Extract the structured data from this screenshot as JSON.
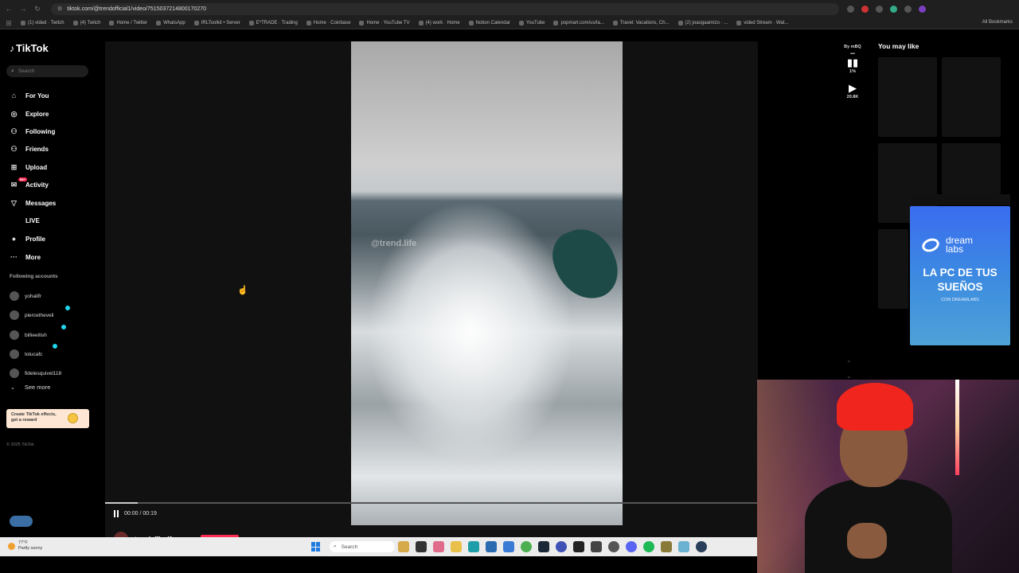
{
  "browser": {
    "url": "tiktok.com/@trendofficial1/video/7515037214800170270",
    "bookmarks": [
      "(1) vided · Twitch",
      "(4) Twitch",
      "Home / Twitter",
      "WhatsApp",
      "IRLToolkit • Server",
      "E*TRADE · Trading",
      "Home · Coinbase",
      "Home · YouTube TV",
      "(4) work · Home",
      "Notion Calendar",
      "YouTube",
      "popmart.com/us/la...",
      "Travel: Vacations, Ch...",
      "(2) joaogaarnizo · ...",
      "vided Stream · Wat..."
    ],
    "all_bookmarks": "All Bookmarks"
  },
  "sidebar": {
    "logo": "TikTok",
    "search_placeholder": "Search",
    "nav": [
      {
        "label": "For You",
        "icon": "home-icon",
        "glyph": "⌂"
      },
      {
        "label": "Explore",
        "icon": "compass-icon",
        "glyph": "◎"
      },
      {
        "label": "Following",
        "icon": "following-icon",
        "glyph": "⚇"
      },
      {
        "label": "Friends",
        "icon": "friends-icon",
        "glyph": "⚇"
      },
      {
        "label": "Upload",
        "icon": "upload-icon",
        "glyph": "⊞"
      },
      {
        "label": "Activity",
        "icon": "activity-icon",
        "glyph": "✉"
      },
      {
        "label": "Messages",
        "icon": "messages-icon",
        "glyph": "▽"
      },
      {
        "label": "LIVE",
        "icon": "live-icon",
        "glyph": ""
      },
      {
        "label": "Profile",
        "icon": "profile-icon",
        "glyph": "●"
      },
      {
        "label": "More",
        "icon": "more-icon",
        "glyph": "···"
      }
    ],
    "activity_badge": "99+",
    "following_header": "Following accounts",
    "accounts": [
      "yohalifr",
      "piercetheveil",
      "billieeilish",
      "tolucafc",
      "fidelesquivel118"
    ],
    "see_more": "See more",
    "effects_promo": "Create TikTok effects, get a reward",
    "copyright": "© 2025 TikTok"
  },
  "player": {
    "time": "00:00 / 00:19",
    "progress": 0.05,
    "author": "trendoffical1",
    "watermark": "@trend.life",
    "actions": {
      "stats_label": "1%",
      "plays": "20.8K",
      "by_label": "By mBQ"
    }
  },
  "you_may_like": {
    "title": "You may like"
  },
  "ad": {
    "brand": "dream labs",
    "headline": "LA PC DE TUS SUEÑOS",
    "sub": "CON DREAMLABS"
  },
  "taskbar": {
    "weather_temp": "77°F",
    "weather_desc": "Partly sunny",
    "search": "Search"
  },
  "colors": {
    "accent": "#fe2c55",
    "live": "#20d5ec",
    "ad": "#3a6cf0"
  }
}
